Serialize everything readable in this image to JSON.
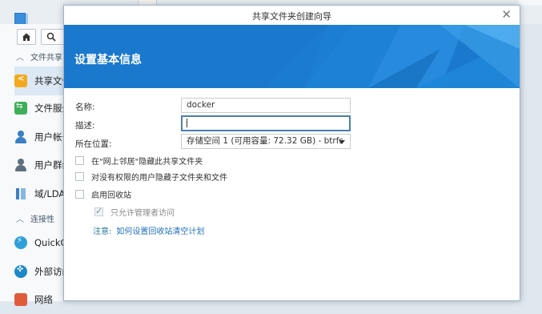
{
  "sidebar": {
    "sections": [
      {
        "label": "文件共享"
      },
      {
        "label": "连接性"
      }
    ],
    "items": [
      {
        "label": "共享文件夹",
        "icon": "shared-folder-icon",
        "active": true
      },
      {
        "label": "文件服务",
        "icon": "file-services-icon"
      },
      {
        "label": "用户帐号",
        "icon": "user-icon"
      },
      {
        "label": "用户群组",
        "icon": "group-icon"
      },
      {
        "label": "域/LDAP",
        "icon": "domain-icon"
      },
      {
        "label": "QuickConnect",
        "icon": "quickconnect-icon"
      },
      {
        "label": "外部访问",
        "icon": "external-access-icon"
      },
      {
        "label": "网络",
        "icon": "network-icon"
      }
    ]
  },
  "dialog": {
    "title": "共享文件夹创建向导",
    "heading": "设置基本信息",
    "close_icon": "close-icon",
    "header_color": "#1a78cd",
    "fields": {
      "name": {
        "label": "名称:",
        "value": "docker"
      },
      "description": {
        "label": "描述:",
        "value": ""
      },
      "location": {
        "label": "所在位置:",
        "value": "存储空间 1 (可用容量:  72.32 GB) - btrfs"
      }
    },
    "checkboxes": [
      {
        "label": "在\"网上邻居\"隐藏此共享文件夹",
        "checked": false,
        "enabled": true
      },
      {
        "label": "对没有权限的用户隐藏子文件夹和文件",
        "checked": false,
        "enabled": true
      },
      {
        "label": "启用回收站",
        "checked": false,
        "enabled": true
      },
      {
        "label": "只允许管理者访问",
        "checked": true,
        "enabled": false
      }
    ],
    "note": {
      "label": "注意:",
      "link": "如何设置回收站清空计划"
    }
  }
}
